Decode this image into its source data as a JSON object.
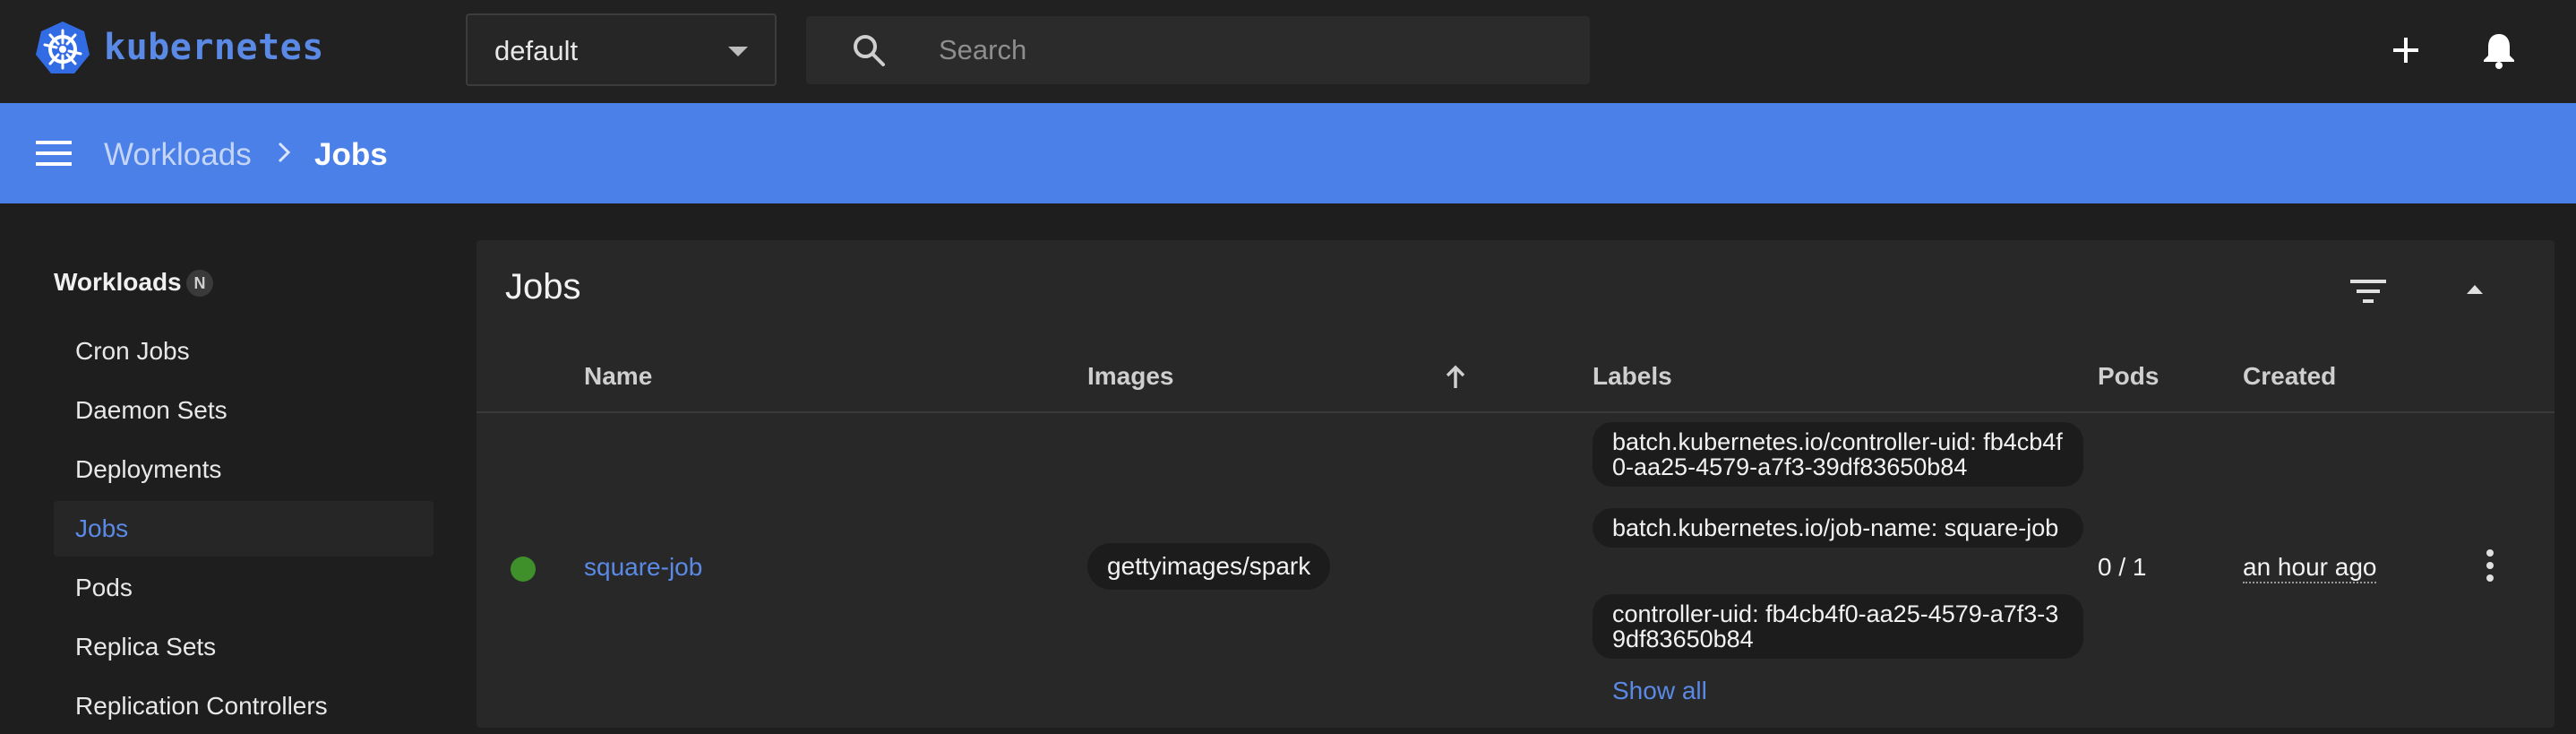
{
  "app": {
    "brand": "kubernetes",
    "namespace": "default",
    "search_placeholder": "Search"
  },
  "breadcrumb": {
    "parent": "Workloads",
    "current": "Jobs"
  },
  "sidebar": {
    "heading": "Workloads",
    "badge": "N",
    "items": [
      {
        "label": "Cron Jobs"
      },
      {
        "label": "Daemon Sets"
      },
      {
        "label": "Deployments"
      },
      {
        "label": "Jobs"
      },
      {
        "label": "Pods"
      },
      {
        "label": "Replica Sets"
      },
      {
        "label": "Replication Controllers"
      }
    ],
    "active_item": "Jobs"
  },
  "jobs_card": {
    "title": "Jobs",
    "columns": [
      "Name",
      "Images",
      "Labels",
      "Pods",
      "Created"
    ],
    "sort_column": "Created",
    "rows": [
      {
        "status": "running",
        "name": "square-job",
        "image": "gettyimages/spark",
        "labels": [
          "batch.kubernetes.io/controller-uid: fb4cb4f0-aa25-4579-a7f3-39df83650b84",
          "batch.kubernetes.io/job-name: square-job",
          "controller-uid: fb4cb4f0-aa25-4579-a7f3-39df83650b84"
        ],
        "show_all": "Show all",
        "pods": "0 / 1",
        "created": "an hour ago"
      }
    ]
  },
  "colors": {
    "accent": "#4b80e8",
    "link": "#5a8ae6",
    "status_ok": "#3f8f2a",
    "background": "#1e1e1e",
    "card": "#282828"
  }
}
